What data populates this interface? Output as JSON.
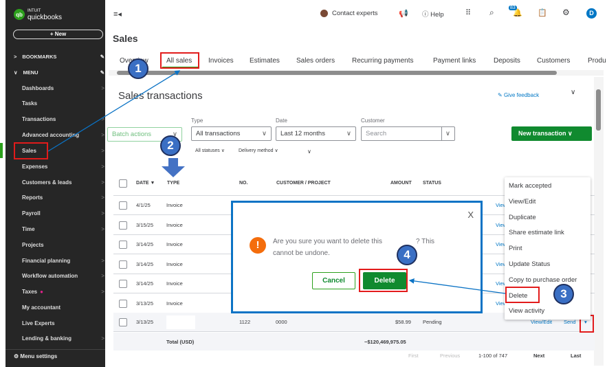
{
  "app": {
    "logo_top": "INTUIT",
    "logo_bottom": "quickbooks",
    "new_label": "+ New"
  },
  "sidebar": {
    "bookmarks": "BOOKMARKS",
    "menu": "MENU",
    "items": [
      {
        "label": "Dashboards",
        "chev": true
      },
      {
        "label": "Tasks",
        "chev": false
      },
      {
        "label": "Transactions",
        "chev": true
      },
      {
        "label": "Advanced accounting",
        "chev": true
      },
      {
        "label": "Sales",
        "chev": true
      },
      {
        "label": "Expenses",
        "chev": true
      },
      {
        "label": "Customers & leads",
        "chev": true
      },
      {
        "label": "Reports",
        "chev": true
      },
      {
        "label": "Payroll",
        "chev": true
      },
      {
        "label": "Time",
        "chev": true
      },
      {
        "label": "Projects",
        "chev": false
      },
      {
        "label": "Financial planning",
        "chev": true
      },
      {
        "label": "Workflow automation",
        "chev": true
      },
      {
        "label": "Taxes",
        "chev": true
      },
      {
        "label": "My accountant",
        "chev": false
      },
      {
        "label": "Live Experts",
        "chev": false
      },
      {
        "label": "Lending & banking",
        "chev": true
      }
    ],
    "menu_settings": "Menu settings"
  },
  "topbar": {
    "contact": "Contact experts",
    "help": "Help",
    "notif_count": "83",
    "avatar": "D"
  },
  "page": {
    "title": "Sales",
    "section_title": "Sales transactions",
    "feedback": "Give feedback"
  },
  "tabs": [
    "Overview",
    "All sales",
    "Invoices",
    "Estimates",
    "Sales orders",
    "Recurring payments",
    "Payment links",
    "Deposits",
    "Customers",
    "Produ"
  ],
  "filters": {
    "batch": "Batch actions",
    "type_label": "Type",
    "type_value": "All transactions",
    "date_label": "Date",
    "date_value": "Last 12 months",
    "customer_label": "Customer",
    "customer_placeholder": "Search",
    "statuses": "All statuses",
    "delivery": "Delivery method",
    "new_txn": "New transaction"
  },
  "table": {
    "headers": [
      "DATE ▼",
      "TYPE",
      "NO.",
      "CUSTOMER / PROJECT",
      "AMOUNT",
      "STATUS"
    ],
    "rows": [
      {
        "date": "4/1/25",
        "type": "Invoice"
      },
      {
        "date": "3/15/25",
        "type": "Invoice"
      },
      {
        "date": "3/14/25",
        "type": "Invoice"
      },
      {
        "date": "3/14/25",
        "type": "Invoice"
      },
      {
        "date": "3/14/25",
        "type": "Invoice"
      },
      {
        "date": "3/13/25",
        "type": "Invoice"
      }
    ],
    "last_row": {
      "date": "3/13/25",
      "no": "1122",
      "customer": "0000",
      "amount": "$58.99",
      "status": "Pending",
      "view": "View/Edit",
      "send": "Send"
    },
    "row_action": "View/Edit",
    "total_label": "Total (USD)",
    "total": "−$120,469,975.05"
  },
  "pagination": {
    "first": "First",
    "previous": "Previous",
    "range": "1-100 of 747",
    "next": "Next",
    "last": "Last"
  },
  "action_menu": [
    "Mark accepted",
    "View/Edit",
    "Duplicate",
    "Share estimate link",
    "Print",
    "Update Status",
    "Copy to purchase order",
    "Delete",
    "View activity"
  ],
  "dialog": {
    "line1": "Are you sure you want to delete this",
    "line1b": "? This",
    "line2": "cannot be undone.",
    "cancel": "Cancel",
    "delete": "Delete",
    "close": "X"
  },
  "annotations": [
    "1",
    "2",
    "3",
    "4"
  ]
}
